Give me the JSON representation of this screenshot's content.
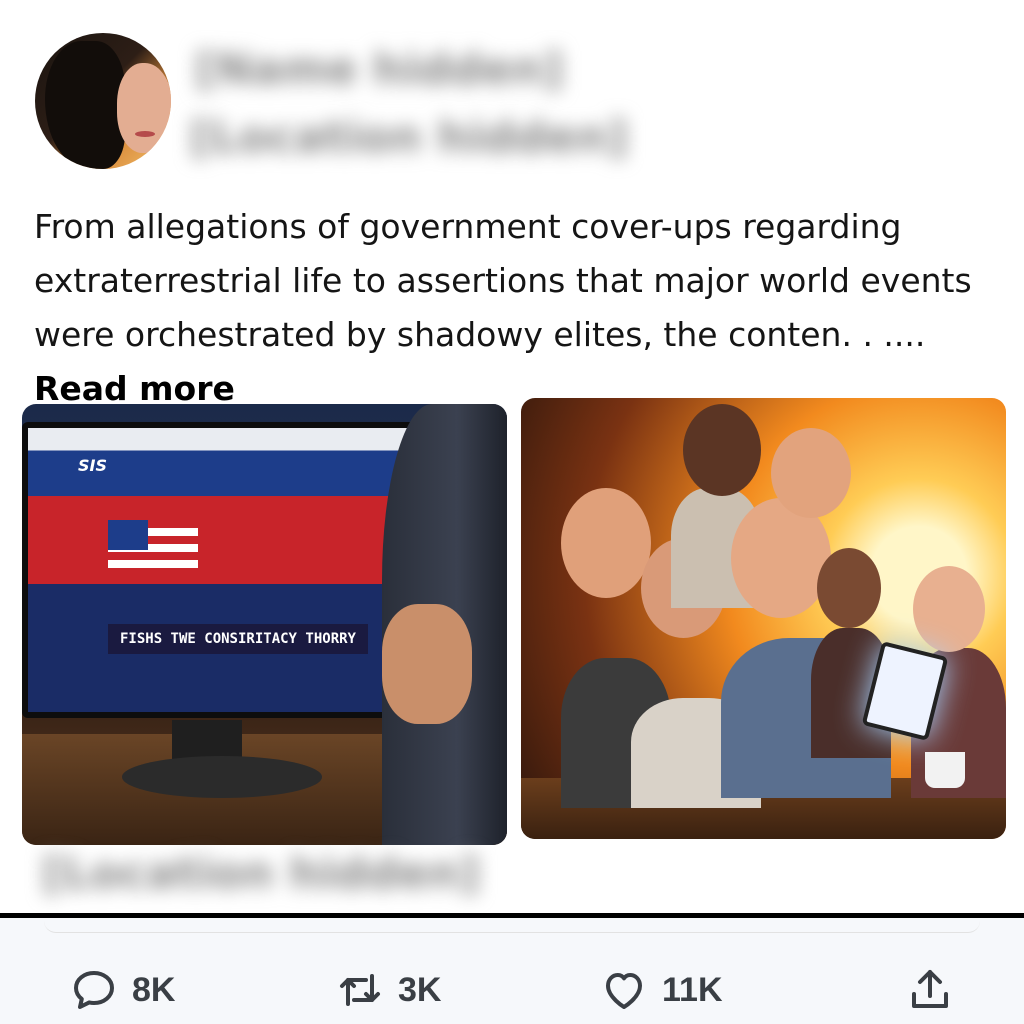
{
  "author": {
    "name": "[Name hidden]",
    "handle": "[Location hidden]"
  },
  "post": {
    "text": " From allegations of government cover-ups regarding extraterrestrial life to assertions that major world events were orchestrated by shadowy elites, the conten. . .... ",
    "read_more": "Read more"
  },
  "images": {
    "left": {
      "logo": "SIS",
      "banner": "FISHS TWE CONSIRITACY THORRY"
    }
  },
  "footer_handle": "[Location hidden]",
  "actions": {
    "reply": {
      "icon": "comment-icon",
      "count": "8K"
    },
    "retweet": {
      "icon": "retweet-icon",
      "count": "3K"
    },
    "like": {
      "icon": "heart-icon",
      "count": "11K"
    },
    "share": {
      "icon": "share-icon"
    }
  },
  "colors": {
    "icon": "#3a3f45",
    "text": "#151515"
  }
}
